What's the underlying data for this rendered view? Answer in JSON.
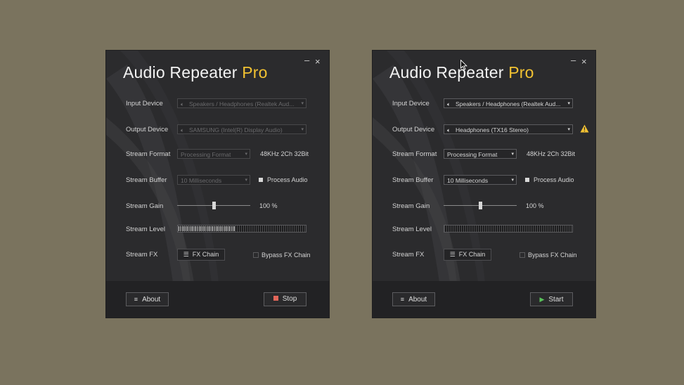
{
  "windows": [
    {
      "title_main": "Audio Repeater ",
      "title_pro": "Pro",
      "minimize": "–",
      "close": "×",
      "labels": {
        "input_device": "Input Device",
        "output_device": "Output Device",
        "stream_format": "Stream Format",
        "stream_buffer": "Stream Buffer",
        "stream_gain": "Stream Gain",
        "stream_level": "Stream Level",
        "stream_fx": "Stream FX"
      },
      "input_device": "Speakers / Headphones (Realtek Aud...",
      "output_device": "SAMSUNG (Intel(R) Display Audio)",
      "stream_format": "Processing Format",
      "format_value": "48KHz 2Ch 32Bit",
      "stream_buffer": "10 Milliseconds",
      "process_audio": "Process Audio",
      "gain_value": "100 %",
      "gain_level": 0.5,
      "stream_level_fraction": 0.45,
      "fx_chain": "FX Chain",
      "bypass_fx": "Bypass FX Chain",
      "about": "About",
      "action": "Stop",
      "controls_disabled": true
    },
    {
      "title_main": "Audio Repeater ",
      "title_pro": "Pro",
      "minimize": "–",
      "close": "×",
      "labels": {
        "input_device": "Input Device",
        "output_device": "Output Device",
        "stream_format": "Stream Format",
        "stream_buffer": "Stream Buffer",
        "stream_gain": "Stream Gain",
        "stream_level": "Stream Level",
        "stream_fx": "Stream FX"
      },
      "input_device": "Speakers / Headphones (Realtek Aud...",
      "output_device": "Headphones (TX16 Stereo)",
      "stream_format": "Processing Format",
      "format_value": "48KHz 2Ch 32Bit",
      "stream_buffer": "10 Milliseconds",
      "process_audio": "Process Audio",
      "gain_value": "100 %",
      "gain_level": 0.5,
      "stream_level_fraction": 0,
      "fx_chain": "FX Chain",
      "bypass_fx": "Bypass FX Chain",
      "about": "About",
      "action": "Start",
      "controls_disabled": false
    }
  ],
  "colors": {
    "background": "#7a735e",
    "window": "#2b2b2d",
    "pro_accent": "#f2c232",
    "stop_icon": "#e2665a",
    "start_icon": "#59c25b",
    "warning": "#f2c232"
  },
  "icons": [
    "speaker-icon",
    "dropdown-arrow-icon",
    "fx-chain-icon",
    "menu-icon",
    "stop-icon",
    "play-icon",
    "warning-icon",
    "minimize-icon",
    "close-icon",
    "mouse-cursor-icon"
  ]
}
